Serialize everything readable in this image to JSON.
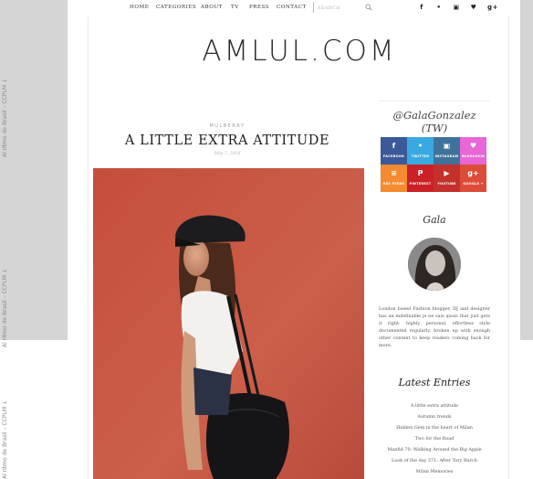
{
  "side_caption": "Al ritmo de Brasil – CCPLM ↓",
  "nav": {
    "items": [
      "HOME",
      "CATEGORIES",
      "ABOUT",
      "TV",
      "PRESS",
      "CONTACT"
    ],
    "search_placeholder": "SEARCH",
    "social": [
      "f",
      "•",
      "▣",
      "♥",
      "g+"
    ]
  },
  "site": {
    "logo": "AMLUL.COM"
  },
  "post": {
    "category": "MULBERRY",
    "title": "A LITTLE EXTRA ATTITUDE",
    "date": "May 7, 2018"
  },
  "sidebar": {
    "handle": "@GalaGonzalez (TW)",
    "social_tiles": [
      {
        "label": "FACEBOOK",
        "icon": "f",
        "color": "#3b5998"
      },
      {
        "label": "TWITTER",
        "icon": "•",
        "color": "#3aa9e1"
      },
      {
        "label": "INSTAGRAM",
        "icon": "▣",
        "color": "#3f729b"
      },
      {
        "label": "BLOGLOVIN",
        "icon": "♥",
        "color": "#e866d6"
      },
      {
        "label": "RSS FEEDS",
        "icon": "≡",
        "color": "#f48a31"
      },
      {
        "label": "PINTEREST",
        "icon": "P",
        "color": "#cb2027"
      },
      {
        "label": "YOUTUBE",
        "icon": "▶",
        "color": "#c4302b"
      },
      {
        "label": "GOOGLE +",
        "icon": "g+",
        "color": "#dd4b39"
      }
    ],
    "name": "Gala",
    "bio": "London based Fashion blogger, DJ and designer has an indefinable je ne sais quois that just gets it right: highly personal, effortless style documented regularly, broken up with enough other content to keep readers coming back for more.",
    "latest_title": "Latest Entries",
    "latest_entries": [
      "A little extra attitude",
      "Autumn trends",
      "Hidden Gem in the heart of Milan",
      "Two for the Road",
      "Manfid 70: Walking Around the Big Apple",
      "Look of the day 571: After Tory Burch",
      "Milan Memories"
    ]
  }
}
